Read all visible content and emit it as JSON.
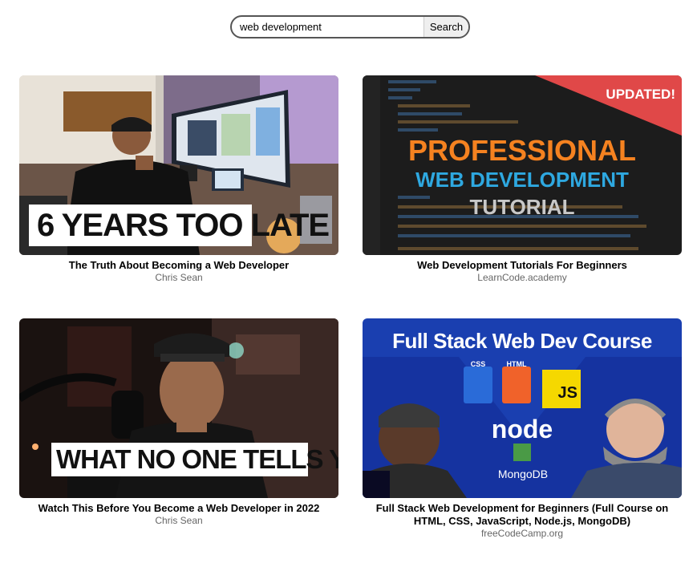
{
  "search": {
    "value": "web development",
    "button_label": "Search"
  },
  "videos": [
    {
      "title": "The Truth About Becoming a Web Developer",
      "channel": "Chris Sean",
      "thumbnail_text": "6 YEARS TOO LATE"
    },
    {
      "title": "Web Development Tutorials For Beginners",
      "channel": "LearnCode.academy",
      "thumbnail_text": {
        "corner": "UPDATED!",
        "line1": "PROFESSIONAL",
        "line2": "WEB DEVELOPMENT",
        "line3": "TUTORIAL"
      }
    },
    {
      "title": "Watch This Before You Become a Web Developer in 2022",
      "channel": "Chris Sean",
      "thumbnail_text": "WHAT NO ONE TELLS YOU"
    },
    {
      "title": "Full Stack Web Development for Beginners (Full Course on HTML, CSS, JavaScript, Node.js, MongoDB)",
      "channel": "freeCodeCamp.org",
      "thumbnail_text": {
        "headline": "Full Stack Web Dev Course",
        "css": "CSS",
        "html": "HTML",
        "js": "JS",
        "node": "node",
        "mongo": "MongoDB"
      }
    }
  ],
  "colors": {
    "accent_red": "#e04848",
    "fcc_blue": "#1a3fb0",
    "orange": "#f58220",
    "blue": "#2ea8e0"
  }
}
